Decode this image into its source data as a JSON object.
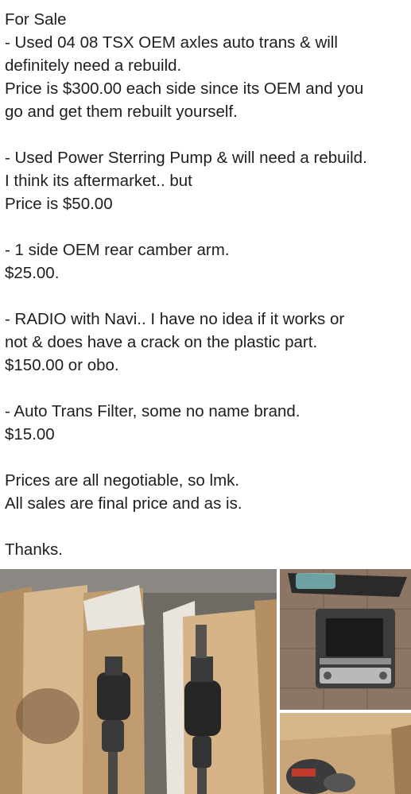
{
  "post": {
    "lines": [
      "For Sale",
      " - Used 04 08 TSX OEM axles auto trans & will",
      "definitely need a rebuild.",
      "Price is $300.00 each side since its OEM and you",
      "go and get them rebuilt yourself.",
      "",
      " - Used Power Sterring Pump & will need a rebuild.",
      "I think its aftermarket.. but",
      "Price is $50.00",
      "",
      " - 1 side OEM rear camber arm.",
      "$25.00.",
      "",
      " - RADIO with Navi.. I have no idea if it works or",
      "not & does have a crack on the plastic part.",
      "$150.00 or obo.",
      "",
      "- Auto Trans Filter, some no name brand.",
      "$15.00",
      "",
      "Prices are all negotiable, so lmk.",
      "All sales are final price and as is.",
      "",
      "Thanks."
    ]
  },
  "photos": [
    {
      "name": "axles-photo",
      "icon": "axles-in-boxes-image"
    },
    {
      "name": "radio-photo",
      "icon": "navi-radio-image"
    },
    {
      "name": "filter-photo",
      "icon": "trans-filter-box-image"
    }
  ],
  "colors": {
    "text": "#1c1e21",
    "background": "#ffffff",
    "cardboard": "#c9a57a",
    "floor": "#6e6a64"
  }
}
